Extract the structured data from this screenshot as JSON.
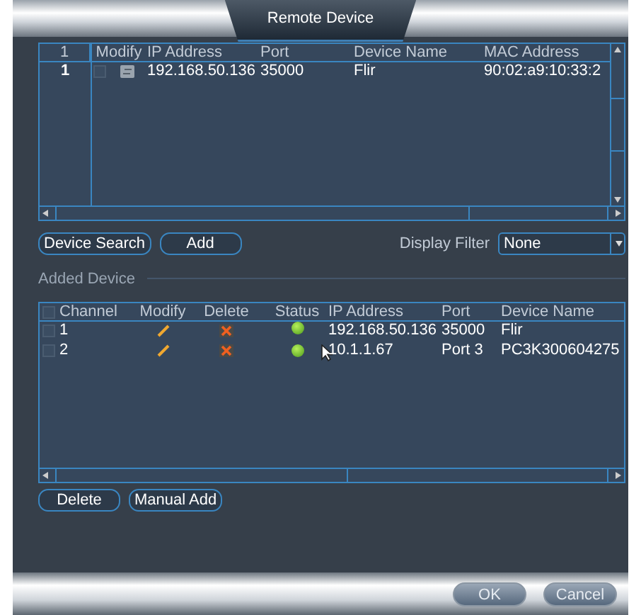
{
  "window": {
    "title": "Remote Device"
  },
  "search_table": {
    "columns": [
      "1",
      "Modify",
      "IP Address",
      "Port",
      "Device Name",
      "MAC Address"
    ],
    "rows": [
      {
        "index": "1",
        "checked": false,
        "ip": "192.168.50.136",
        "port": "35000",
        "device_name": "Flir",
        "mac": "90:02:a9:10:33:2"
      }
    ]
  },
  "search_buttons": [
    "Device Search",
    "Add"
  ],
  "display_filter": {
    "label": "Display Filter",
    "value": "None"
  },
  "added_section": {
    "title": "Added Device"
  },
  "added_table": {
    "all_checked": false,
    "columns": [
      "Channel",
      "Modify",
      "Delete",
      "Status",
      "IP Address",
      "Port",
      "Device Name"
    ],
    "rows": [
      {
        "channel": "1",
        "checked": false,
        "online": true,
        "ip": "192.168.50.136",
        "port": "35000",
        "device_name": "Flir"
      },
      {
        "channel": "2",
        "checked": false,
        "online": true,
        "ip": "10.1.1.67",
        "port": "Port 3",
        "device_name": "PC3K300604275"
      }
    ]
  },
  "added_buttons": [
    "Delete",
    "Manual Add"
  ],
  "footer_buttons": [
    "OK",
    "Cancel"
  ]
}
